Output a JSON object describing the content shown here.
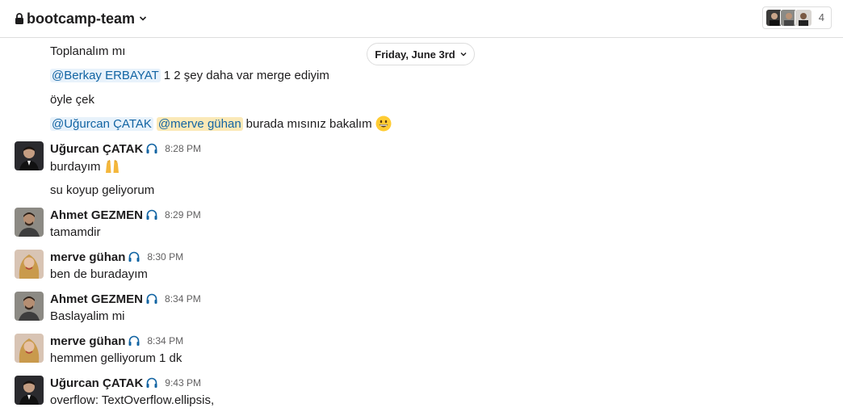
{
  "header": {
    "channel_name": "bootcamp-team",
    "member_count": "4"
  },
  "date_divider": "Friday, June 3rd",
  "messages": [
    {
      "text": "Toplanalım mı"
    },
    {
      "mentions": [
        "@Berkay ERBAYAT"
      ],
      "text": "1 2 şey daha var merge ediyim"
    },
    {
      "text": "öyle çek"
    },
    {
      "mentions": [
        "@Uğurcan ÇATAK",
        "@merve gühan"
      ],
      "text": "burada mısınız bakalım",
      "emoji": "grinning-face"
    },
    {
      "author": "Uğurcan ÇATAK",
      "time": "8:28 PM",
      "text": "burdayım",
      "emoji": "raising-hands"
    },
    {
      "text": "su koyup geliyorum"
    },
    {
      "author": "Ahmet GEZMEN",
      "time": "8:29 PM",
      "text": "tamamdir"
    },
    {
      "author": "merve gühan",
      "time": "8:30 PM",
      "text": "ben de buradayım"
    },
    {
      "author": "Ahmet GEZMEN",
      "time": "8:34 PM",
      "text": "Baslayalim mi"
    },
    {
      "author": "merve gühan",
      "time": "8:34 PM",
      "text": "hemmen gelliyorum 1 dk"
    },
    {
      "author": "Uğurcan ÇATAK",
      "time": "9:43 PM",
      "text": "overflow: TextOverflow.ellipsis,"
    }
  ],
  "icons": {
    "lock": "lock-icon",
    "chevron": "chevron-down-icon",
    "headset": "headphones-icon"
  },
  "colors": {
    "mention_bg": "#e8f2fb",
    "mention_text": "#1264a3",
    "self_mention_bg": "#fbe9b7",
    "headset_blue": "#1264a3"
  }
}
